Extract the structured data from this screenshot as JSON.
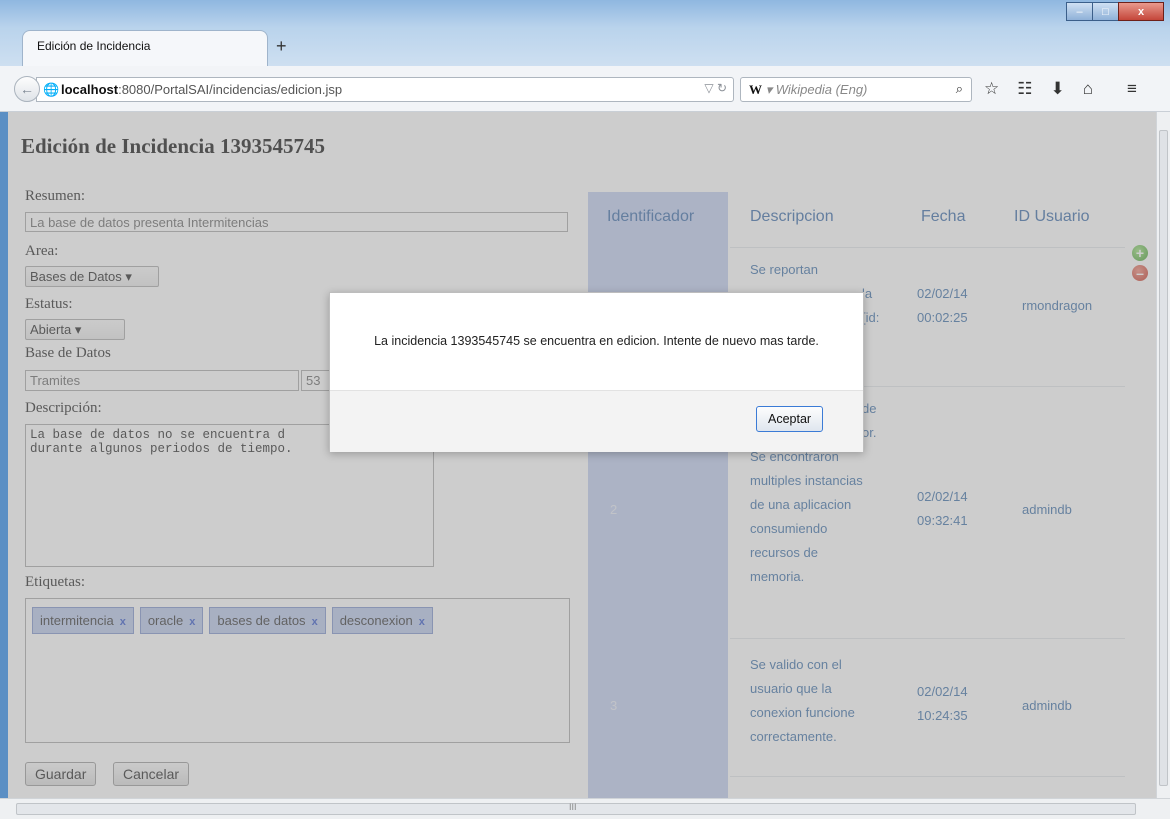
{
  "browser": {
    "tab_title": "Edición de Incidencia",
    "new_tab": "+",
    "url_host": "localhost",
    "url_rest": ":8080/PortalSAI/incidencias/edicion.jsp",
    "search_engine_glyph": "W",
    "search_placeholder": "Wikipedia (Eng)",
    "window_buttons": {
      "minimize": "–",
      "maximize": "□",
      "close": "x"
    },
    "icons": [
      "back-arrow-icon",
      "globe-icon",
      "reload-icon",
      "search-icon",
      "star-icon",
      "bookmarks-icon",
      "download-icon",
      "home-icon",
      "menu-icon"
    ]
  },
  "page": {
    "title": "Edición de Incidencia 1393545745",
    "form": {
      "resumen_label": "Resumen:",
      "resumen_value": "La base de datos presenta Intermitencias",
      "area_label": "Area:",
      "area_value": "Bases de Datos",
      "estatus_label": "Estatus:",
      "estatus_value": "Abierta",
      "base_label": "Base de Datos",
      "base_value": "Tramites",
      "base_id": "53",
      "descripcion_label": "Descripción:",
      "descripcion_value": "La base de datos no se encuentra d\ndurante algunos periodos de tiempo.",
      "etiquetas_label": "Etiquetas:",
      "tags": [
        "intermitencia",
        "oracle",
        "bases de datos",
        "desconexion"
      ],
      "tag_remove": "x",
      "guardar": "Guardar",
      "cancelar": "Cancelar"
    },
    "table": {
      "headers": [
        "Identificador",
        "Descripcion",
        "Fecha",
        "ID Usuario"
      ],
      "rows": [
        {
          "id": "",
          "desc_lines": [
            "Se reportan",
            "",
            "la",
            "[id:"
          ],
          "date": "02/02/14",
          "time": "00:02:25",
          "user": "rmondragon"
        },
        {
          "id": "2",
          "desc_lines": [
            "de",
            "or.",
            "Se encontraron",
            "multiples instancias",
            "de una aplicacion",
            "consumiendo",
            "recursos de",
            "memoria."
          ],
          "date": "02/02/14",
          "time": "09:32:41",
          "user": "admindb"
        },
        {
          "id": "3",
          "desc_lines": [
            "Se valido con el",
            "usuario que la",
            "conexion funcione",
            "correctamente."
          ],
          "date": "02/02/14",
          "time": "10:24:35",
          "user": "admindb"
        }
      ]
    }
  },
  "dialog": {
    "message": "La incidencia 1393545745 se encuentra en edicion. Intente de nuevo mas tarde.",
    "ok_label": "Aceptar"
  },
  "scroll": {
    "h_thumb_glyph": "III"
  },
  "colors": {
    "id_column": "#c0cdf0",
    "header_text": "#3769a8",
    "tag_bg": "#b9c7ea",
    "overlay": "#969696"
  }
}
